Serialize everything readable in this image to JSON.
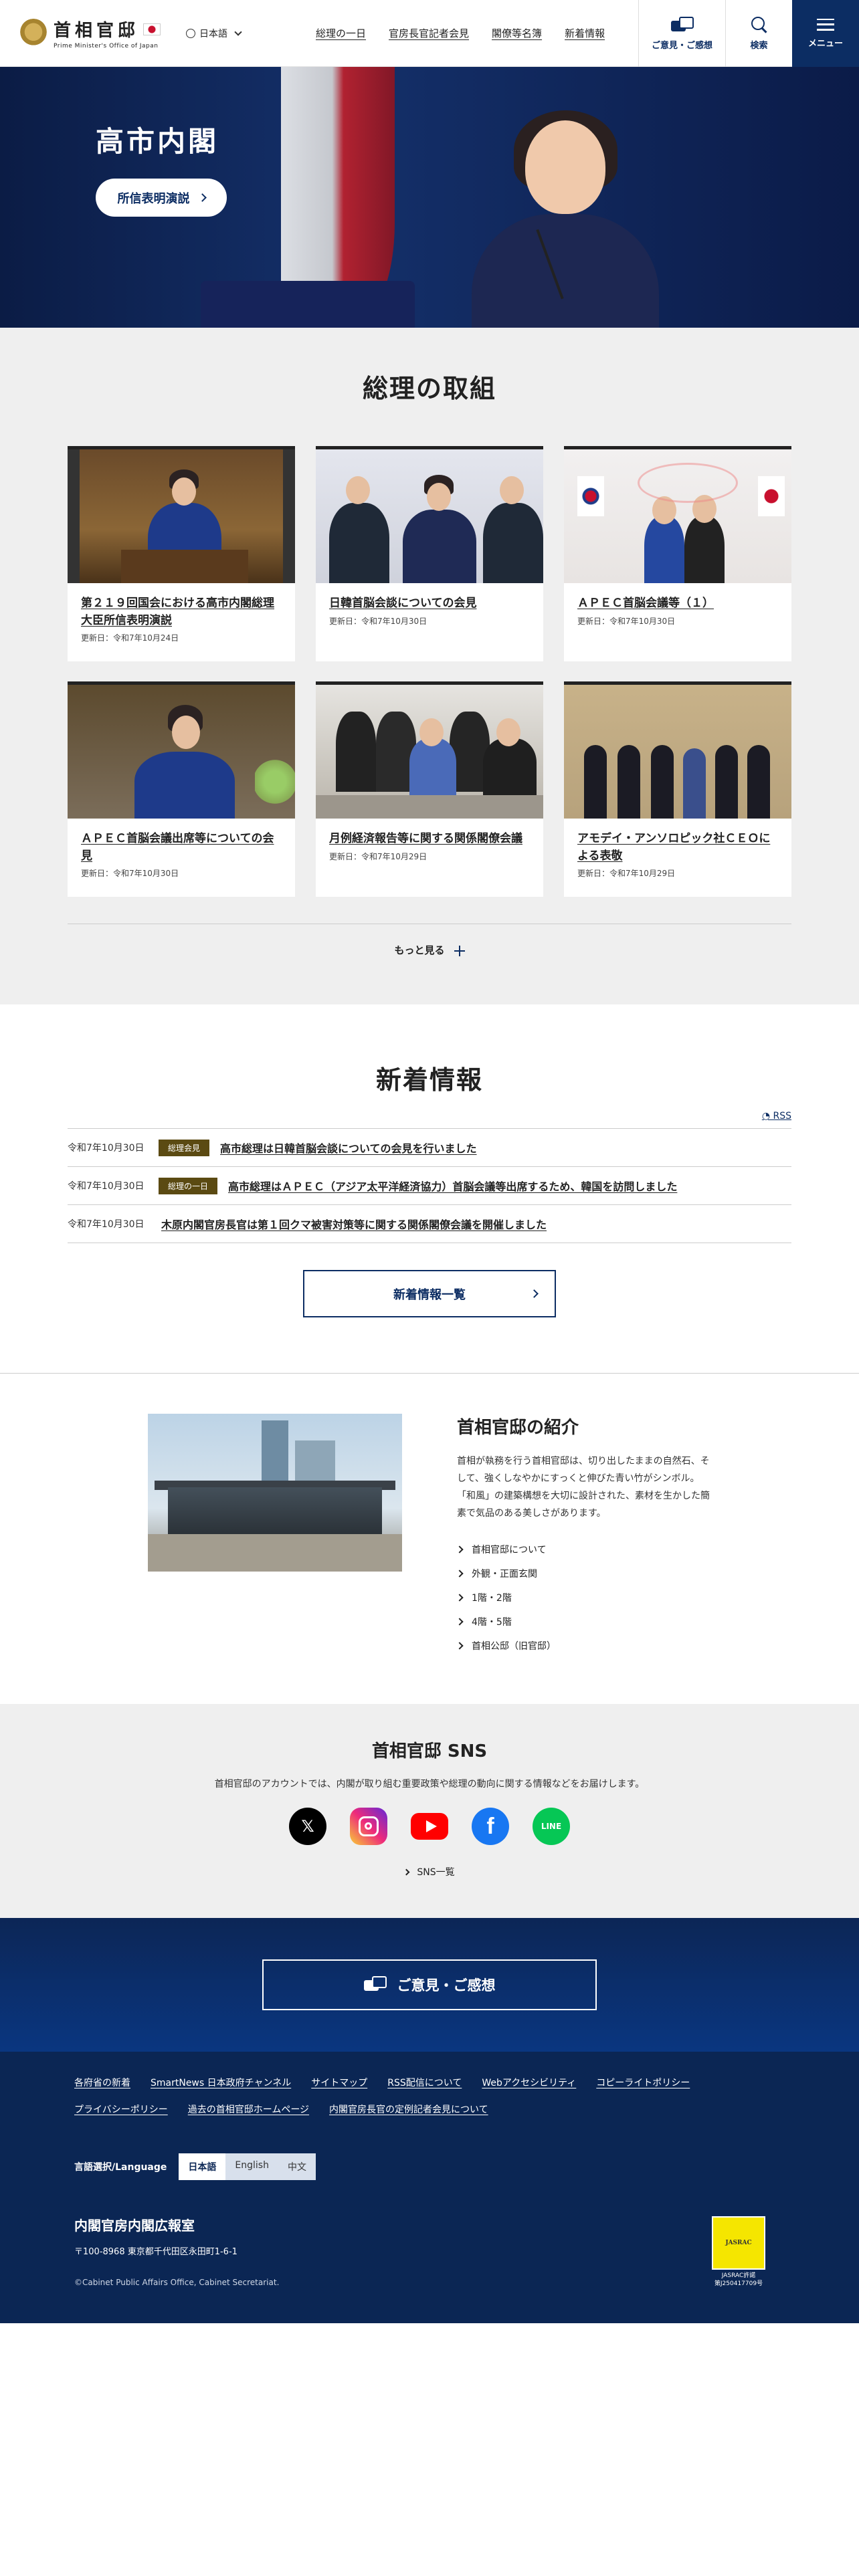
{
  "header": {
    "logo_jp": "首相官邸",
    "logo_en": "Prime Minister's Office of Japan",
    "lang": "日本語",
    "nav": [
      "総理の一日",
      "官房長官記者会見",
      "閣僚等名簿",
      "新着情報"
    ],
    "opinion": "ご意見・ご感想",
    "search": "検索",
    "menu": "メニュー"
  },
  "hero": {
    "title": "高市内閣",
    "button": "所信表明演説"
  },
  "torikumi": {
    "title": "総理の取組",
    "cards": [
      {
        "title": "第２１９回国会における高市内閣総理大臣所信表明演説",
        "date": "更新日：令和7年10月24日"
      },
      {
        "title": "日韓首脳会談についての会見",
        "date": "更新日：令和7年10月30日"
      },
      {
        "title": "ＡＰＥＣ首脳会議等（１）",
        "date": "更新日：令和7年10月30日"
      },
      {
        "title": "ＡＰＥＣ首脳会議出席等についての会見",
        "date": "更新日：令和7年10月30日"
      },
      {
        "title": "月例経済報告等に関する関係閣僚会議",
        "date": "更新日：令和7年10月29日"
      },
      {
        "title": "アモデイ・アンソロピック社ＣＥＯによる表敬",
        "date": "更新日：令和7年10月29日"
      }
    ],
    "more": "もっと見る"
  },
  "news": {
    "title": "新着情報",
    "rss": "RSS",
    "items": [
      {
        "date": "令和7年10月30日",
        "badge": "総理会見",
        "text": "高市総理は日韓首脳会談についての会見を行いました"
      },
      {
        "date": "令和7年10月30日",
        "badge": "総理の一日",
        "text": "高市総理はＡＰＥＣ（アジア太平洋経済協力）首脳会議等出席するため、韓国を訪問しました"
      },
      {
        "date": "令和7年10月30日",
        "badge": "",
        "text": "木原内閣官房長官は第１回クマ被害対策等に関する関係閣僚会議を開催しました"
      }
    ],
    "button": "新着情報一覧"
  },
  "intro": {
    "title": "首相官邸の紹介",
    "text": "首相が執務を行う首相官邸は、切り出したままの自然石、そして、強くしなやかにすっくと伸びた青い竹がシンボル。「和風」の建築構想を大切に設計された、素材を生かした簡素で気品のある美しさがあります。",
    "links": [
      "首相官邸について",
      "外観・正面玄関",
      "1階・2階",
      "4階・5階",
      "首相公邸（旧官邸）"
    ]
  },
  "sns": {
    "title": "首相官邸 SNS",
    "text": "首相官邸のアカウントでは、内閣が取り組む重要政策や総理の動向に関する情報などをお届けします。",
    "icons": [
      "x-icon",
      "instagram-icon",
      "youtube-icon",
      "facebook-icon",
      "line-icon"
    ],
    "line_label": "LINE",
    "fb_label": "f",
    "x_label": "𝕏",
    "list": "SNS一覧"
  },
  "opinion_button": "ご意見・ご感想",
  "footer": {
    "links": [
      "各府省の新着",
      "SmartNews 日本政府チャンネル",
      "サイトマップ",
      "RSS配信について",
      "Webアクセシビリティ",
      "コピーライトポリシー",
      "プライバシーポリシー",
      "過去の首相官邸ホームページ",
      "内閣官房長官の定例記者会見について"
    ],
    "lang_label": "言語選択/Language",
    "langs": [
      "日本語",
      "English",
      "中文"
    ],
    "org": "内閣官房内閣広報室",
    "address": "〒100-8968 東京都千代田区永田町1-6-1",
    "copyright": "©Cabinet Public Affairs Office, Cabinet Secretariat.",
    "jasrac_logo": "JASRAC",
    "jasrac_text1": "JASRAC許諾",
    "jasrac_text2": "第J250417709号"
  },
  "colors": {
    "navy": "#0c2d63",
    "badge": "#5b4a12",
    "footer": "#0b2654"
  }
}
